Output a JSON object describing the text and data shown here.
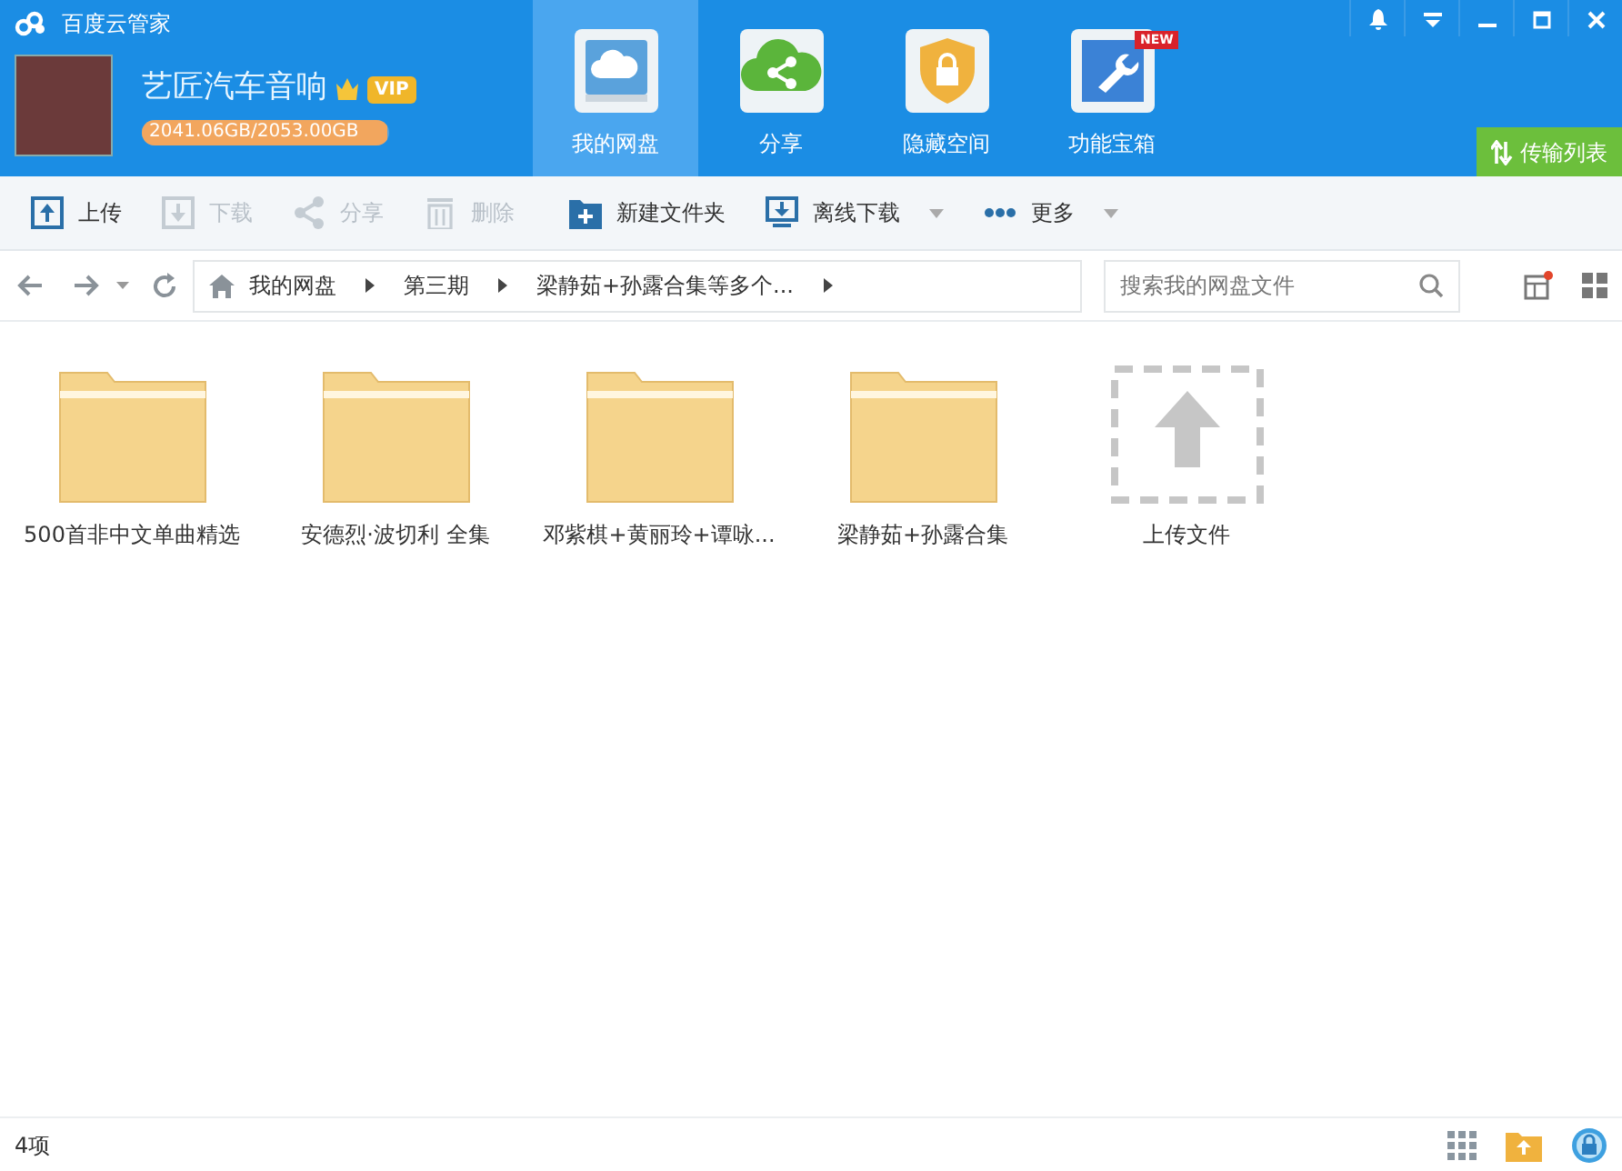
{
  "app_title": "百度云管家",
  "user": {
    "name": "艺匠汽车音响",
    "vip_badge": "VIP",
    "storage": "2041.06GB/2053.00GB",
    "level": 0.994
  },
  "nav_tabs": [
    {
      "label": "我的网盘",
      "selected": true
    },
    {
      "label": "分享",
      "selected": false
    },
    {
      "label": "隐藏空间",
      "selected": false
    },
    {
      "label": "功能宝箱",
      "selected": false,
      "badge": "NEW"
    }
  ],
  "transfer_button": "传输列表",
  "toolbar": [
    {
      "label": "上传",
      "disabled": false,
      "dropdown": false
    },
    {
      "label": "下载",
      "disabled": true,
      "dropdown": false
    },
    {
      "label": "分享",
      "disabled": true,
      "dropdown": false
    },
    {
      "label": "删除",
      "disabled": true,
      "dropdown": false
    },
    {
      "label": "新建文件夹",
      "disabled": false,
      "dropdown": false
    },
    {
      "label": "离线下载",
      "disabled": false,
      "dropdown": true
    },
    {
      "label": "更多",
      "disabled": false,
      "dropdown": true
    }
  ],
  "breadcrumb": [
    "我的网盘",
    "第三期",
    "梁静茹+孙露合集等多个..."
  ],
  "search": {
    "placeholder": "搜索我的网盘文件"
  },
  "files": [
    {
      "name": "500首非中文单曲精选",
      "kind": "folder"
    },
    {
      "name": "安德烈·波切利 全集",
      "kind": "folder"
    },
    {
      "name": "邓紫棋+黄丽玲+谭咏...",
      "kind": "folder"
    },
    {
      "name": "梁静茹+孙露合集",
      "kind": "folder"
    },
    {
      "name": "上传文件",
      "kind": "upload"
    }
  ],
  "status_bar": "4项"
}
